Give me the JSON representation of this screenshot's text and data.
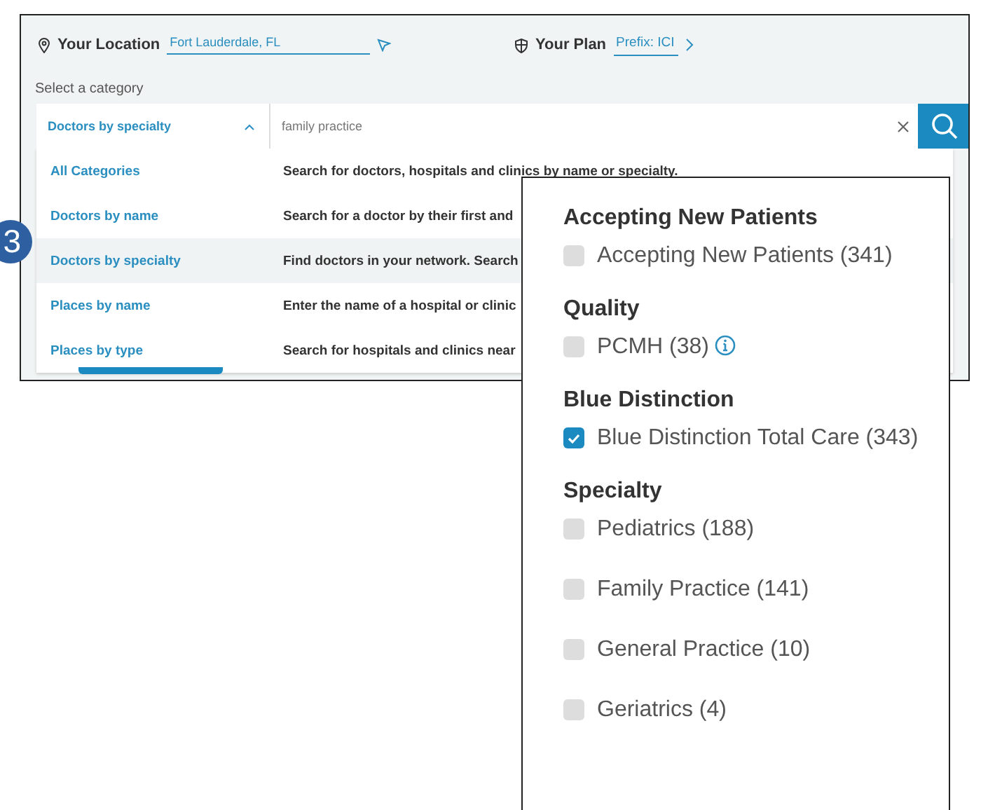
{
  "location": {
    "label": "Your Location",
    "value": "Fort Lauderdale, FL"
  },
  "plan": {
    "label": "Your Plan",
    "value": "Prefix: ICI"
  },
  "category_label": "Select a category",
  "category_select": {
    "value": "Doctors by specialty",
    "expanded": true
  },
  "search": {
    "value": "family practice"
  },
  "categories": [
    {
      "name": "All Categories",
      "description": "Search for doctors, hospitals and clinics by name or specialty.",
      "selected": false
    },
    {
      "name": "Doctors by name",
      "description": "Search for a doctor by their first and",
      "selected": false
    },
    {
      "name": "Doctors by specialty",
      "description": "Find doctors in your network. Search",
      "selected": true
    },
    {
      "name": "Places by name",
      "description": "Enter the name of a hospital or clinic",
      "selected": false
    },
    {
      "name": "Places by type",
      "description": "Search for hospitals and clinics near",
      "selected": false
    }
  ],
  "step_badge": "3",
  "filters": [
    {
      "heading": "Accepting New Patients",
      "options": [
        {
          "label": "Accepting New Patients (341)",
          "checked": false,
          "info": false
        }
      ]
    },
    {
      "heading": "Quality",
      "options": [
        {
          "label": "PCMH (38)",
          "checked": false,
          "info": true
        }
      ]
    },
    {
      "heading": "Blue Distinction",
      "options": [
        {
          "label": "Blue Distinction Total Care (343)",
          "checked": true,
          "info": false
        }
      ]
    },
    {
      "heading": "Specialty",
      "options": [
        {
          "label": "Pediatrics (188)",
          "checked": false,
          "info": false
        },
        {
          "label": "Family Practice (141)",
          "checked": false,
          "info": false
        },
        {
          "label": "General Practice (10)",
          "checked": false,
          "info": false
        },
        {
          "label": "Geriatrics (4)",
          "checked": false,
          "info": false
        }
      ]
    }
  ]
}
